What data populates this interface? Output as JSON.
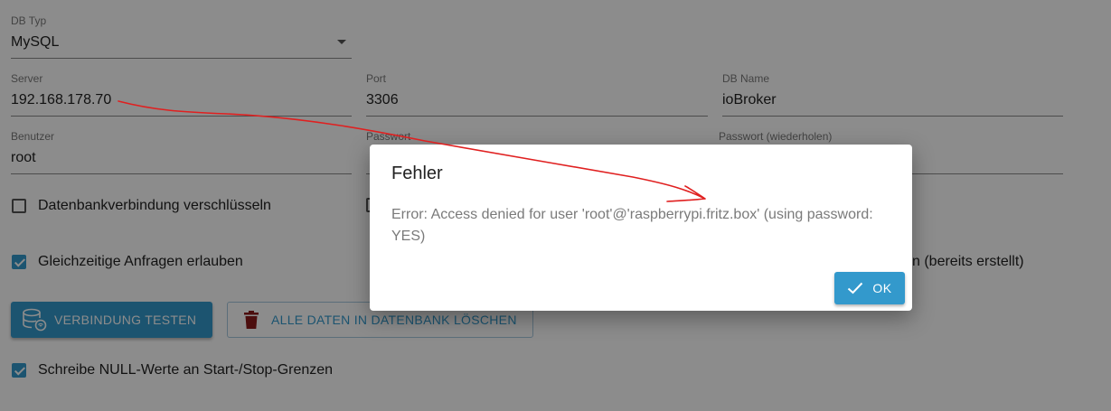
{
  "form": {
    "db_type": {
      "label": "DB Typ",
      "value": "MySQL"
    },
    "server": {
      "label": "Server",
      "value": "192.168.178.70"
    },
    "port": {
      "label": "Port",
      "value": "3306"
    },
    "db_name": {
      "label": "DB Name",
      "value": "ioBroker"
    },
    "user": {
      "label": "Benutzer",
      "value": "root"
    },
    "password": {
      "label": "Passwort"
    },
    "password_repeat": {
      "label": "Passwort (wiederholen)"
    },
    "encrypt": {
      "label": "Datenbankverbindung verschlüsseln",
      "checked": false
    },
    "concurrent": {
      "label": "Gleichzeitige Anfragen erlauben",
      "checked": true
    },
    "already_created_tail": "n (bereits erstellt)",
    "null_values": {
      "label": "Schreibe NULL-Werte an Start-/Stop-Grenzen",
      "checked": true
    }
  },
  "buttons": {
    "test_connection": "VERBINDUNG TESTEN",
    "delete_all": "ALLE DATEN IN DATENBANK LÖSCHEN"
  },
  "dialog": {
    "title": "Fehler",
    "message": "Error: Access denied for user 'root'@'raspberrypi.fritz.box' (using password: YES)",
    "ok_label": "OK"
  },
  "colors": {
    "primary": "#3399cc",
    "annotation": "#e02020",
    "danger_icon": "#8b1a1a"
  },
  "icons": {
    "test_connection": "database-icon",
    "delete_all": "trash-icon",
    "ok": "check-icon",
    "db_type_select": "chevron-down-icon"
  }
}
